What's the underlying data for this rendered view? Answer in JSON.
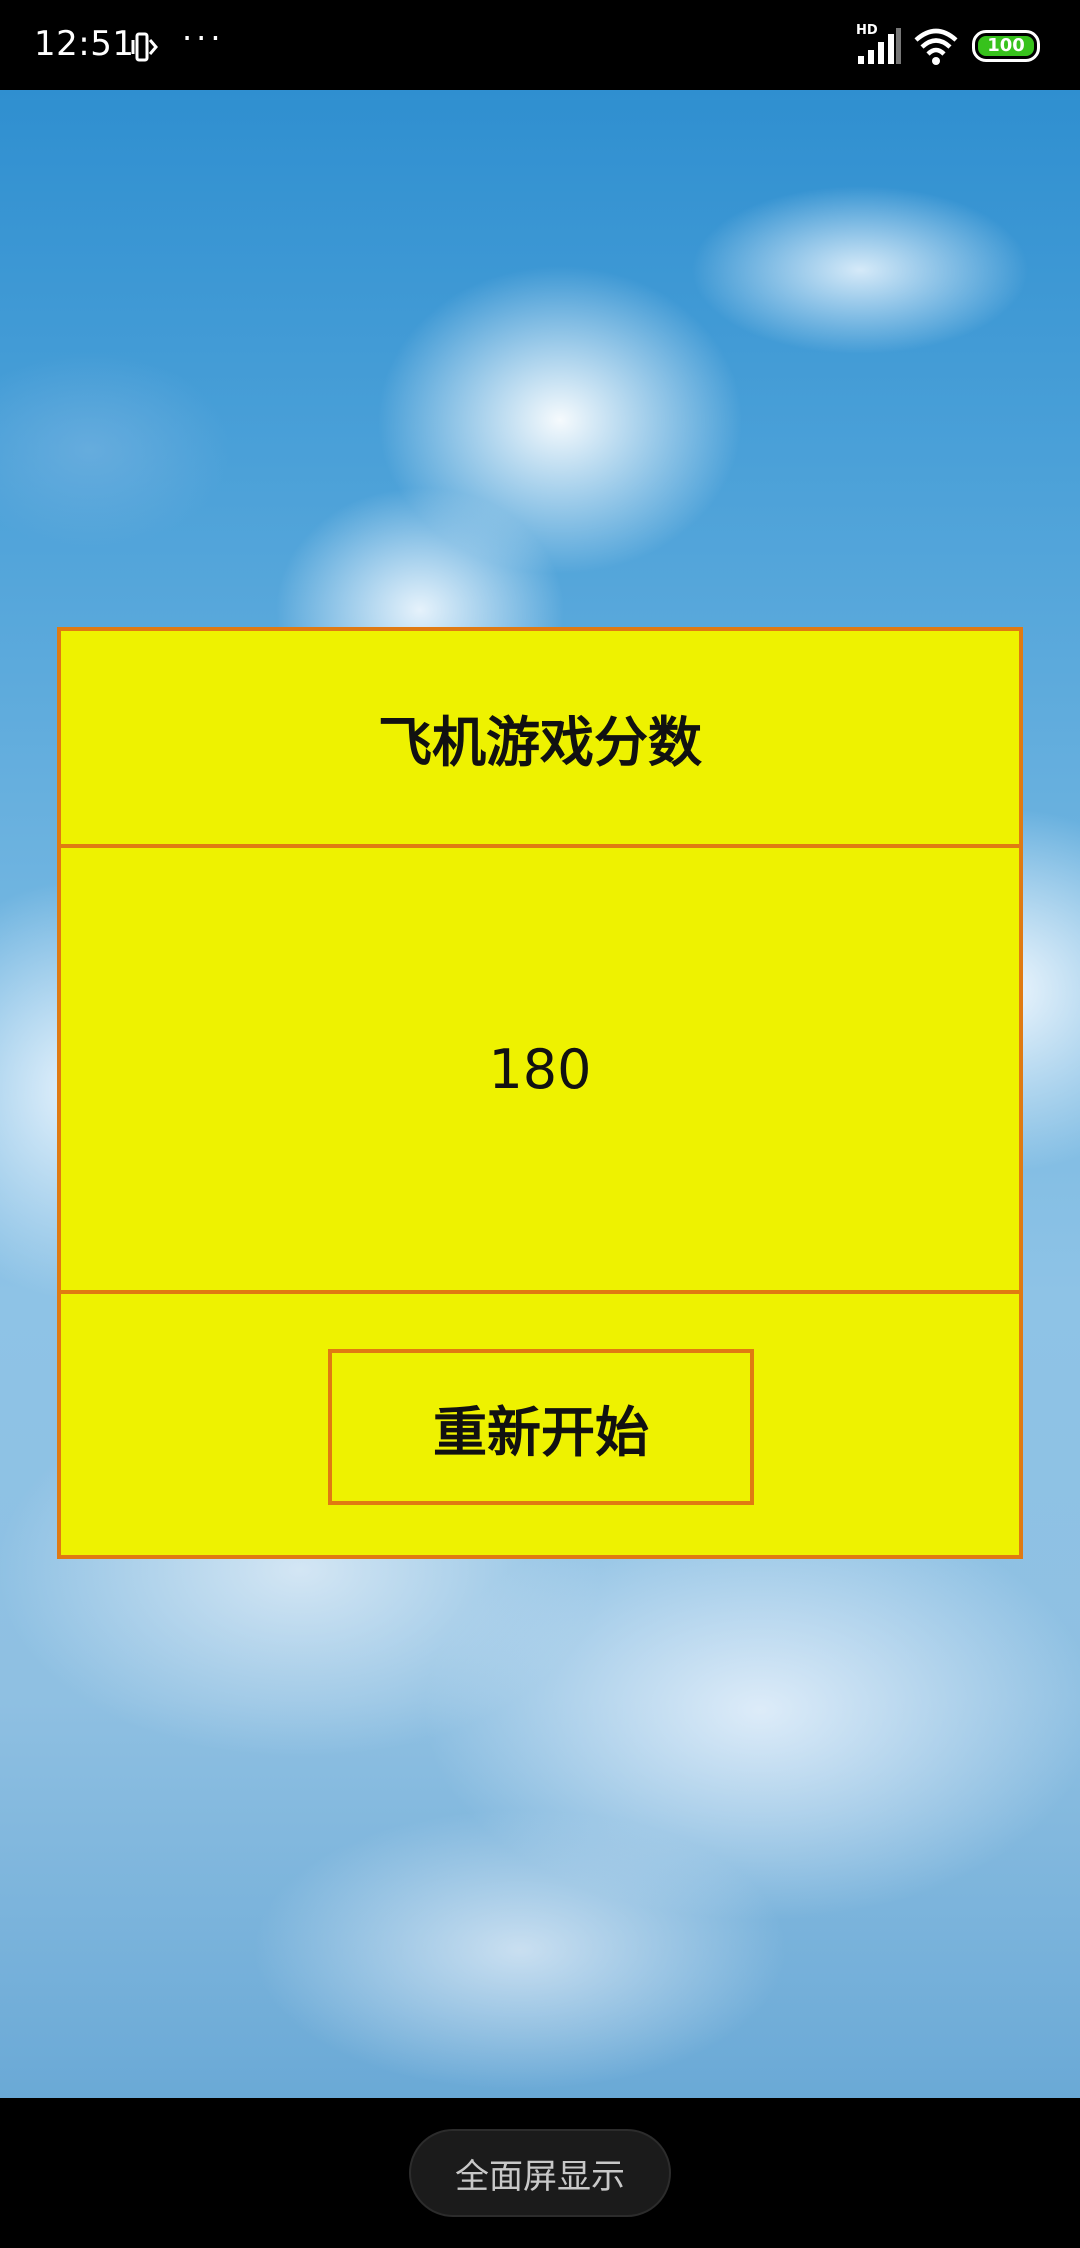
{
  "status_bar": {
    "time": "12:51",
    "more_indicator": "···",
    "network_label": "HD",
    "battery_level": "100",
    "icons": [
      "vibrate-icon",
      "signal-icon",
      "wifi-icon",
      "battery-icon"
    ]
  },
  "score_dialog": {
    "title": "飞机游戏分数",
    "score": "180",
    "restart_label": "重新开始"
  },
  "bottom_bar": {
    "fullscreen_label": "全面屏显示"
  },
  "colors": {
    "panel_background": "#eef200",
    "panel_border": "#e07a12",
    "battery_fill": "#37c21c",
    "sky": "#6fb4e0"
  }
}
